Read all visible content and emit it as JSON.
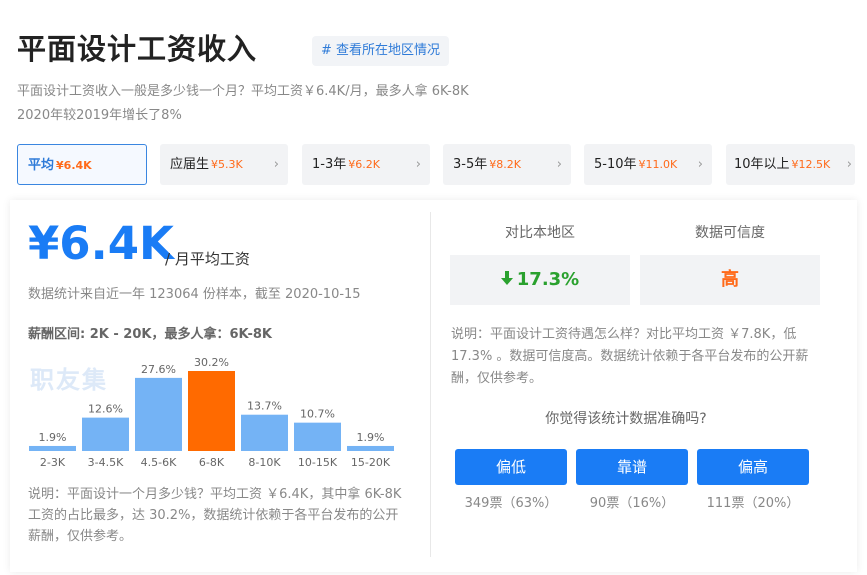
{
  "header": {
    "title": "平面设计工资收入",
    "region_link": "# 查看所在地区情况",
    "desc_line1": "平面设计工资收入一般是多少钱一个月？平均工资￥6.4K/月，最多人拿 6K-8K",
    "desc_line2": "2020年较2019年增长了8%"
  },
  "tabs": [
    {
      "label": "平均",
      "amount": "¥6.4K",
      "active": true
    },
    {
      "label": "应届生",
      "amount": "¥5.3K"
    },
    {
      "label": "1-3年",
      "amount": "¥6.2K"
    },
    {
      "label": "3-5年",
      "amount": "¥8.2K"
    },
    {
      "label": "5-10年",
      "amount": "¥11.0K"
    },
    {
      "label": "10年以上",
      "amount": "¥12.5K"
    }
  ],
  "summary": {
    "salary": "¥6.4K",
    "unit": "/ 月平均工资",
    "stats": "数据统计来自近一年 123064 份样本，截至 2020-10-15",
    "range": "薪酬区间: 2K - 20K，最多人拿：6K-8K",
    "watermark": "职友集",
    "note": "说明：平面设计一个月多少钱？平均工资 ￥6.4K，其中拿 6K-8K 工资的占比最多，达 30.2%，数据统计依赖于各平台发布的公开薪酬，仅供参考。"
  },
  "chart_data": {
    "type": "bar",
    "categories": [
      "2-3K",
      "3-4.5K",
      "4.5-6K",
      "6-8K",
      "8-10K",
      "10-15K",
      "15-20K"
    ],
    "values": [
      1.9,
      12.6,
      27.6,
      30.2,
      13.7,
      10.7,
      1.9
    ],
    "labels": [
      "1.9%",
      "12.6%",
      "27.6%",
      "30.2%",
      "13.7%",
      "10.7%",
      "1.9%"
    ],
    "highlight_index": 3,
    "ylim": [
      0,
      30.2
    ],
    "colors": {
      "normal": "#74b3f5",
      "highlight": "#ff6a00"
    }
  },
  "compare": {
    "local_label": "对比本地区",
    "local_value": "17.3%",
    "local_arrow": "down-arrow-icon",
    "local_color": "#2aa12e",
    "credibility_label": "数据可信度",
    "credibility_value": "高",
    "credibility_color": "#ff6a1a",
    "note": "说明：平面设计工资待遇怎么样？对比平均工资 ￥7.8K，低 17.3% 。数据可信度高。数据统计依赖于各平台发布的公开薪酬，仅供参考。"
  },
  "vote": {
    "question": "你觉得该统计数据准确吗?",
    "options": [
      {
        "label": "偏低",
        "count": "349票（63%）"
      },
      {
        "label": "靠谱",
        "count": "90票（16%）"
      },
      {
        "label": "偏高",
        "count": "111票（20%）"
      }
    ]
  }
}
